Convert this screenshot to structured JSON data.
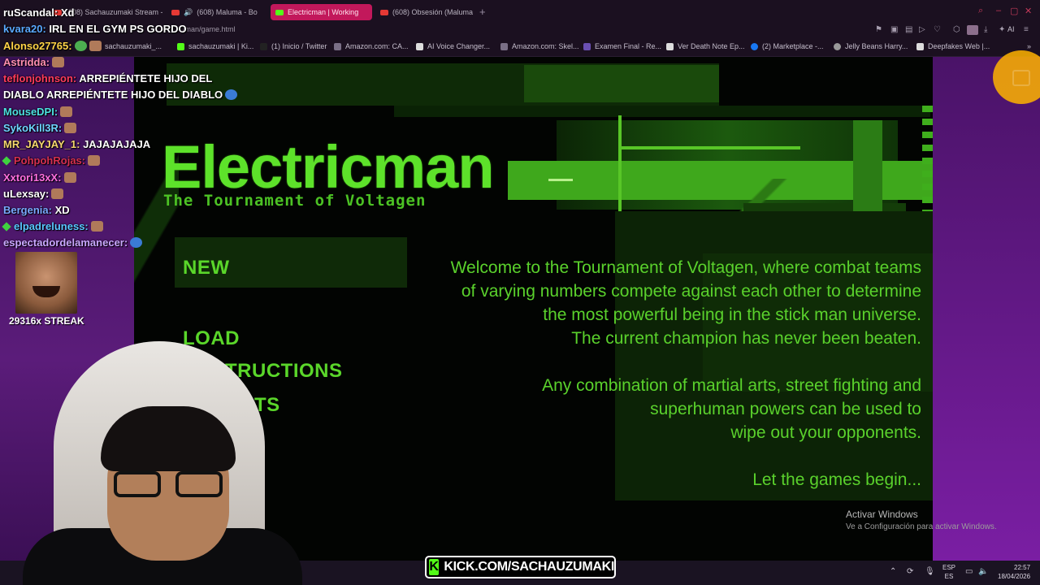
{
  "browser": {
    "tabs": [
      {
        "label": "(608) Sachauzumaki Stream - W",
        "close": "",
        "kind": "yt",
        "active": false
      },
      {
        "label": "(608) Maluma - Bo",
        "close": "✕",
        "kind": "yt",
        "active": false
      },
      {
        "label": "Electricman | Working",
        "close": "",
        "kind": "kick",
        "active": true
      },
      {
        "label": "(608) Obsesión (Maluma)",
        "close": "",
        "kind": "yt",
        "active": false
      }
    ],
    "new_tab": "+",
    "url": "/man/game.html",
    "ai_label": "AI",
    "bookmarks": [
      "sachauzumaki_...",
      "sachauzumaki | Ki...",
      "(1) Inicio / Twitter",
      "Amazon.com: CA...",
      "AI Voice Changer...",
      "Amazon.com: Skel...",
      "Examen Final - Re...",
      "Ver Death Note Ep...",
      "(2) Marketplace -...",
      "Jelly Beans Harry...",
      "Deepfakes Web |..."
    ]
  },
  "game": {
    "title": "Electricman",
    "subtitle": "The Tournament of Voltagen",
    "menu": {
      "new": "NEW",
      "load": "LOAD",
      "instructions": "TRUCTIONS",
      "credits": "TS"
    },
    "intro": [
      "Welcome to the Tournament of Voltagen, where combat teams",
      "of varying numbers compete against each other to determine",
      "the most powerful being in the stick man universe.",
      "The current champion has never been beaten."
    ],
    "intro2": [
      "Any combination of martial arts, street fighting and",
      "superhuman powers can be used to",
      "wipe out your opponents."
    ],
    "closing": "Let the games begin..."
  },
  "windows": {
    "activate_title": "Activar Windows",
    "activate_sub": "Ve a Configuración para activar Windows.",
    "lang_top": "ESP",
    "lang_bottom": "ES",
    "time": "22:57",
    "date": "18/04/2026"
  },
  "chat": [
    {
      "user": "ruScandal:",
      "msg": "Xd",
      "color": "#ffffff"
    },
    {
      "user": "kvara20:",
      "msg": "IRL EN EL GYM PS GORDO",
      "color": "#5aa9ff"
    },
    {
      "user": "Alonso27765:",
      "msg": "",
      "color": "#ffd447"
    },
    {
      "user": "Astridda:",
      "msg": "",
      "color": "#ff8fb1"
    },
    {
      "user": "teflonjohnson:",
      "msg": "ARREPIÉNTETE HIJO DEL",
      "color": "#ff3b5c"
    },
    {
      "user": "",
      "msg": "DIABLO ARREPIÉNTETE HIJO DEL DIABLO",
      "color": "#ffffff"
    },
    {
      "user": "MouseDPI:",
      "msg": "",
      "color": "#4de0e0"
    },
    {
      "user": "SykoKill3R:",
      "msg": "",
      "color": "#6fd4ff"
    },
    {
      "user": "MR_JAYJAY_1:",
      "msg": "JAJAJAJAJA",
      "color": "#f5d76e"
    },
    {
      "user": "PohpohRojas:",
      "msg": "",
      "color": "#d6304f"
    },
    {
      "user": "Xxtori13xX:",
      "msg": "",
      "color": "#ff6fe0"
    },
    {
      "user": "uLexsay:",
      "msg": "",
      "color": "#ffffff"
    },
    {
      "user": "Bergenia:",
      "msg": "XD",
      "color": "#7aa8ff"
    },
    {
      "user": "elpadreluness:",
      "msg": "",
      "color": "#59c7ff"
    },
    {
      "user": "espectadordelamanecer:",
      "msg": "",
      "color": "#c9a8ff"
    }
  ],
  "streak": "29316x STREAK",
  "kick_banner": "KICK.COM/SACHAUZUMAKI",
  "kick_logo": "K",
  "colors": {
    "game_green": "#5ad62a",
    "kick_green": "#53fc18",
    "tab_active": "#c2185b"
  }
}
